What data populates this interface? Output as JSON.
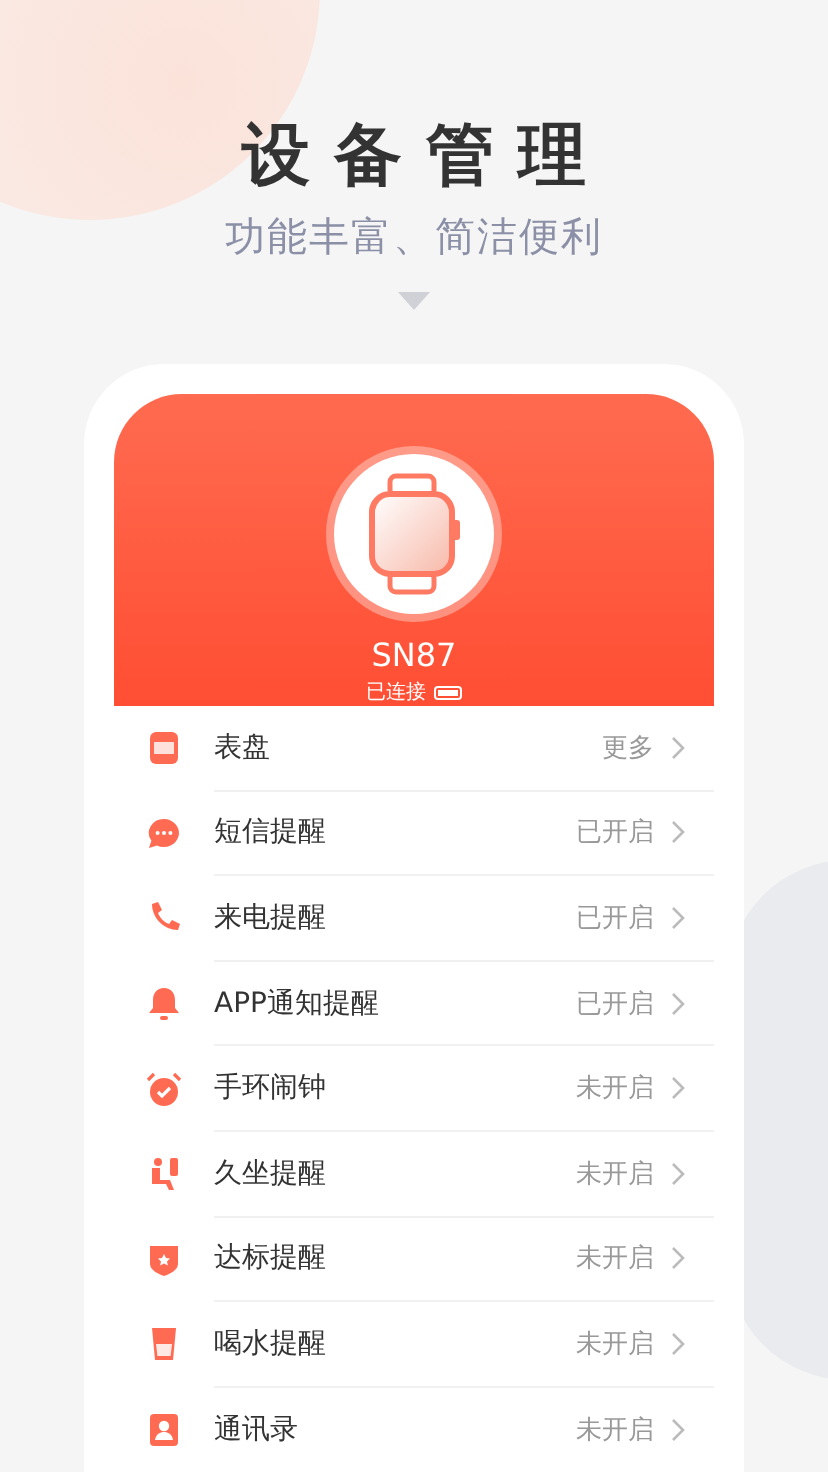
{
  "headline": "设备管理",
  "subtitle": "功能丰富、简洁便利",
  "device": {
    "name": "SN87",
    "status": "已连接"
  },
  "menu": [
    {
      "label": "表盘",
      "value": "更多"
    },
    {
      "label": "短信提醒",
      "value": "已开启"
    },
    {
      "label": "来电提醒",
      "value": "已开启"
    },
    {
      "label": "APP通知提醒",
      "value": "已开启"
    },
    {
      "label": "手环闹钟",
      "value": "未开启"
    },
    {
      "label": "久坐提醒",
      "value": "未开启"
    },
    {
      "label": "达标提醒",
      "value": "未开启"
    },
    {
      "label": "喝水提醒",
      "value": "未开启"
    },
    {
      "label": "通讯录",
      "value": "未开启"
    }
  ]
}
